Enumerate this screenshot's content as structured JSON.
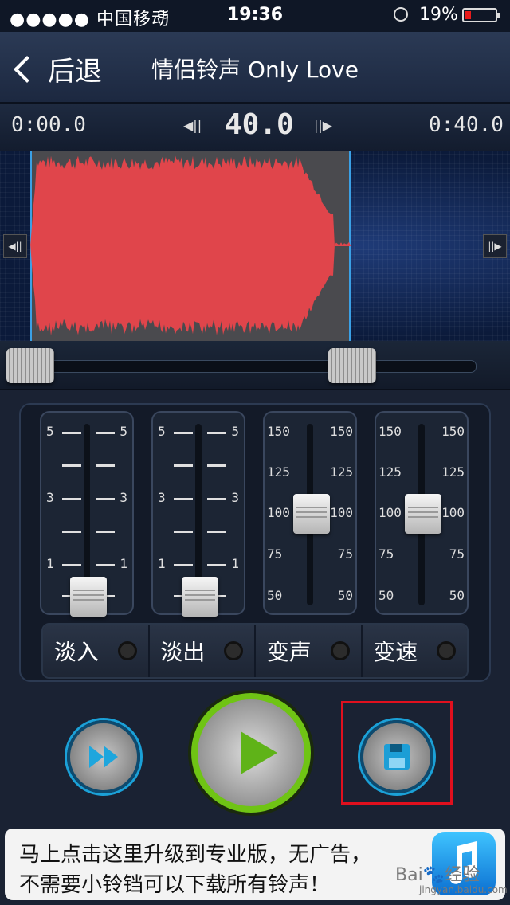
{
  "status": {
    "carrier": "●●●●● 中国移动",
    "time": "19:36",
    "battery": "19%",
    "battery_level": 0.19
  },
  "nav": {
    "back_label": "后退",
    "title": "情侣铃声 Only Love"
  },
  "timebar": {
    "start": "0:00.0",
    "duration": "40.0",
    "end": "0:40.0"
  },
  "sliders": [
    {
      "ticks": [
        "5",
        "3",
        "1"
      ],
      "value": 0,
      "mode": "淡入"
    },
    {
      "ticks": [
        "5",
        "3",
        "1"
      ],
      "value": 0,
      "mode": "淡出"
    },
    {
      "ticks": [
        "150",
        "125",
        "100",
        "75",
        "50"
      ],
      "value": 100,
      "mode": "变声"
    },
    {
      "ticks": [
        "150",
        "125",
        "100",
        "75",
        "50"
      ],
      "value": 100,
      "mode": "变速"
    }
  ],
  "modes": [
    "淡入",
    "淡出",
    "变声",
    "变速"
  ],
  "ad": {
    "line1": "马上点击这里升级到专业版，无广告，",
    "line2": "不需要小铃铛可以下载所有铃声！",
    "watermark": "Bai🐾经验",
    "watermark_url": "jingyan.baidu.com"
  },
  "colors": {
    "waveform": "#e0454b",
    "play_ring": "#6fc414",
    "accent": "#1ba1d8",
    "highlight": "#e0101e"
  }
}
